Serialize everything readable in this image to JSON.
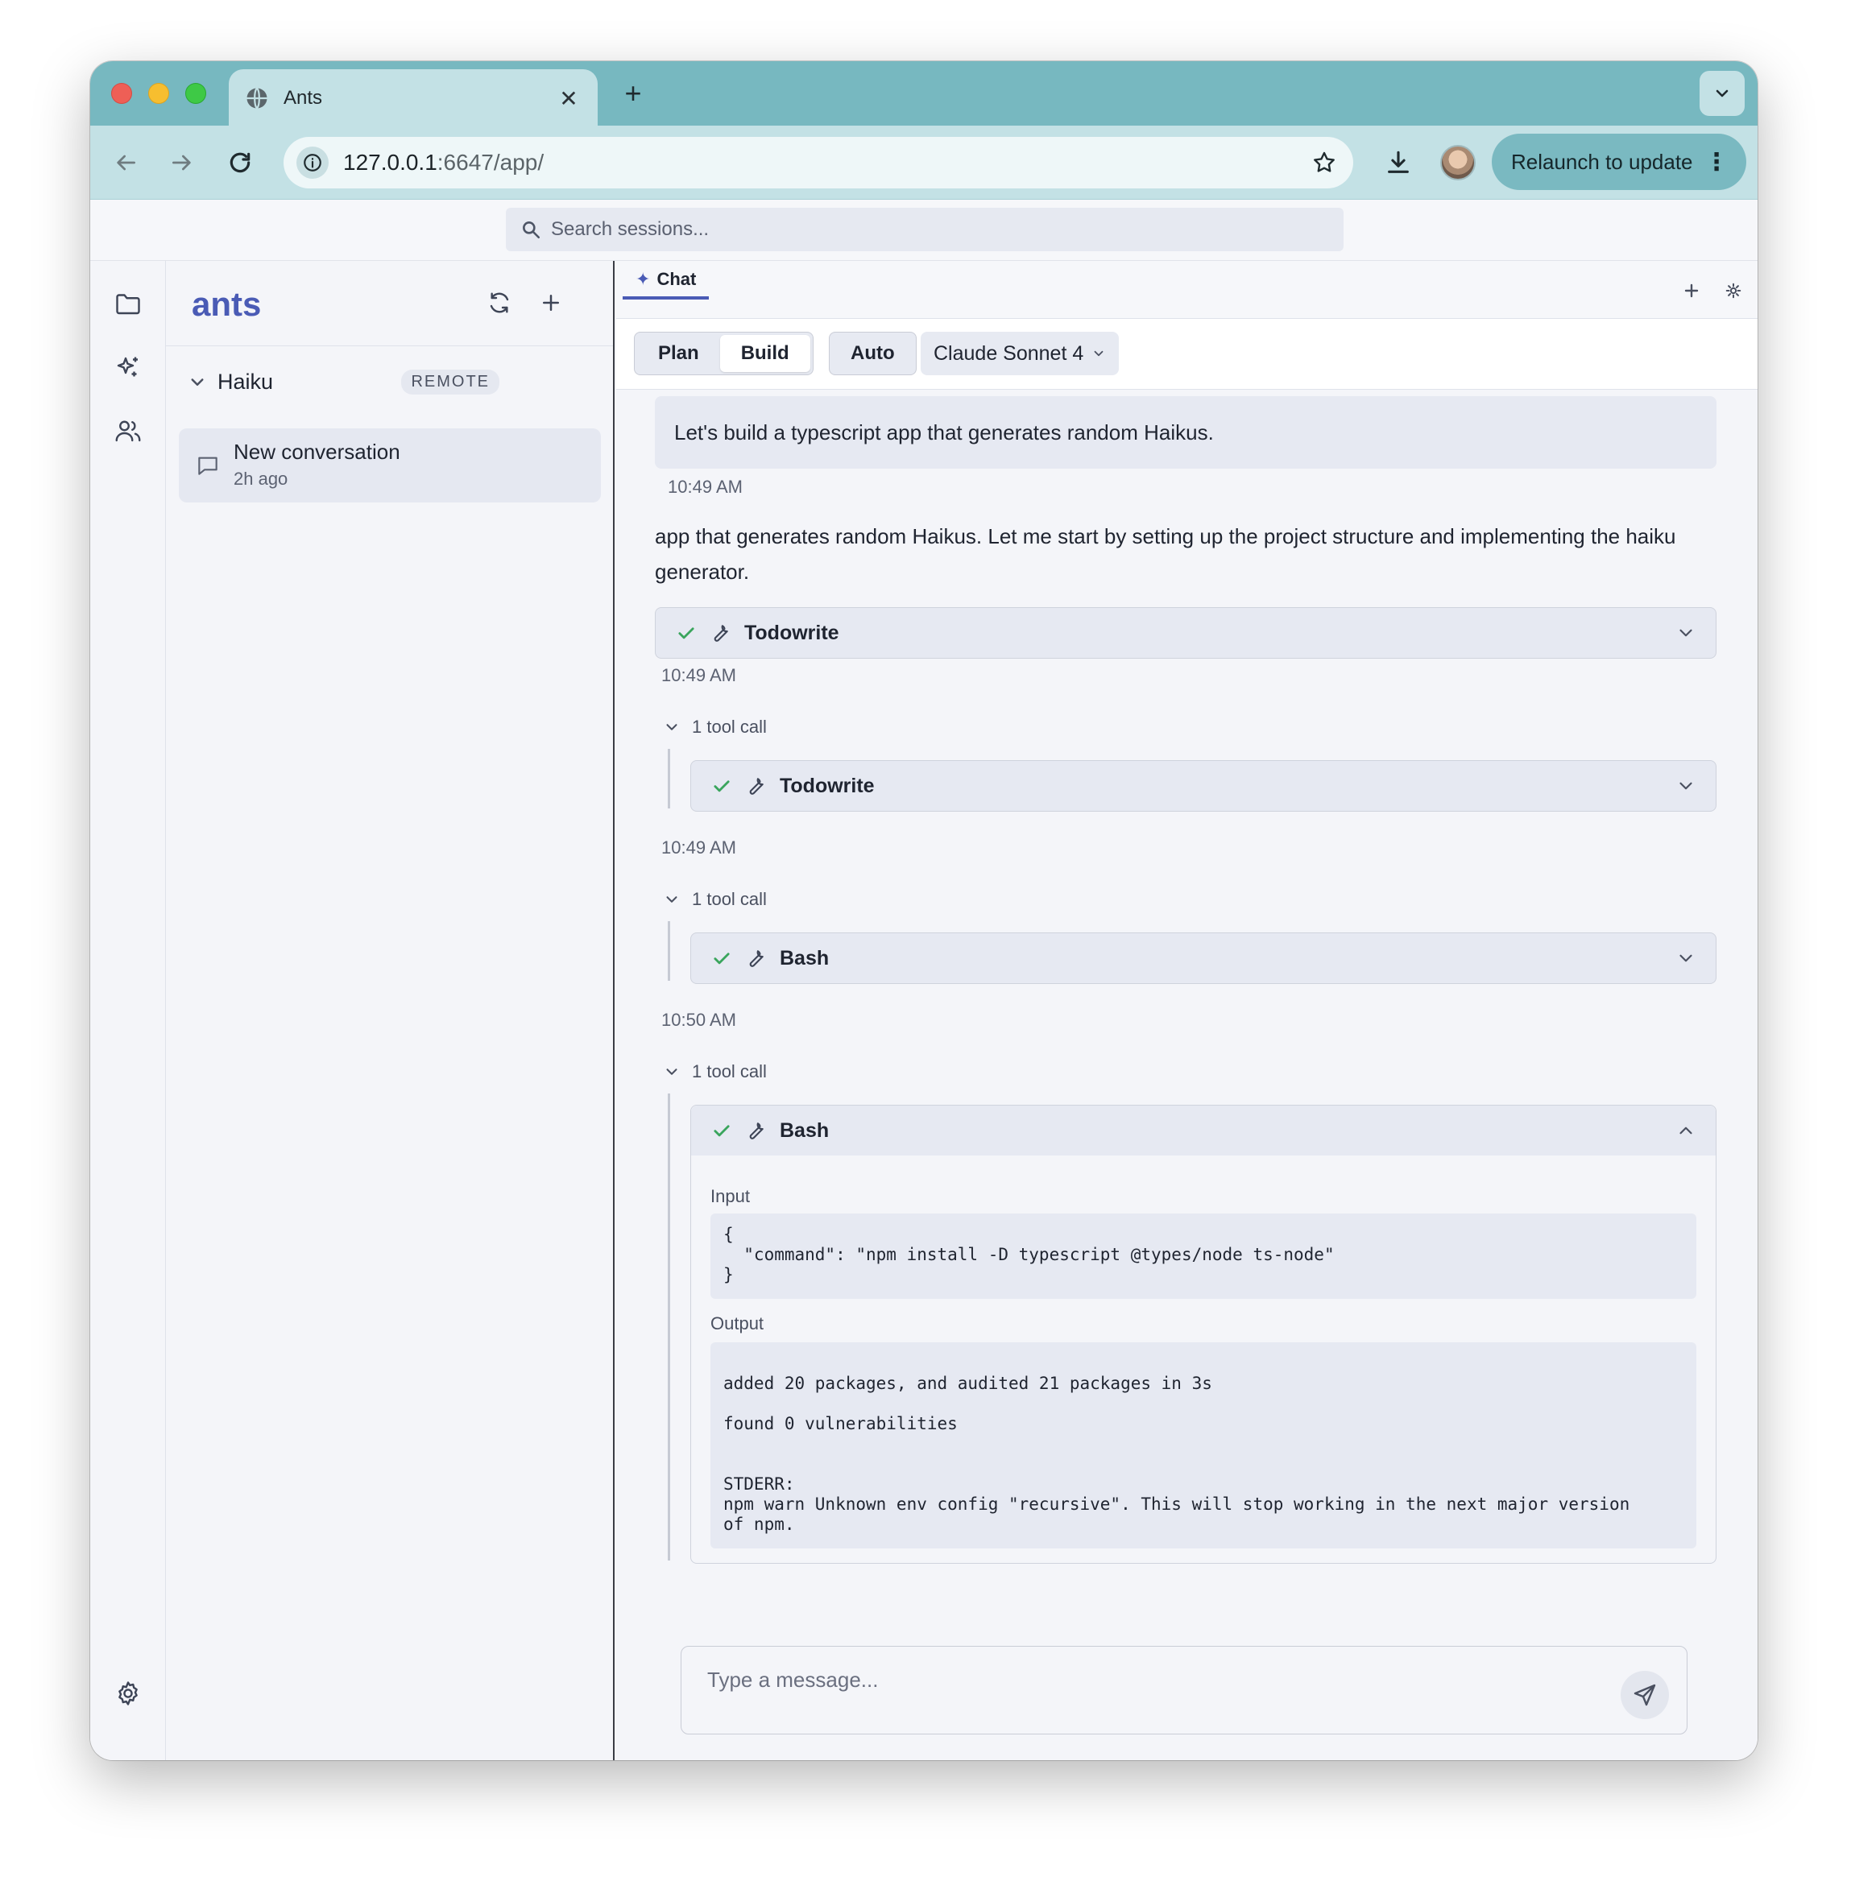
{
  "browser": {
    "tab_title": "Ants",
    "tab_close": "✕",
    "new_tab": "+",
    "url_host": "127.0.0.1",
    "url_rest": ":6647/app/",
    "relaunch_label": "Relaunch to update",
    "relaunch_menu": "⋮"
  },
  "search": {
    "placeholder": "Search sessions..."
  },
  "sessions": {
    "project_title": "ants",
    "group": {
      "name": "Haiku",
      "badge": "REMOTE"
    },
    "conversations": [
      {
        "title": "New conversation",
        "time": "2h ago"
      }
    ]
  },
  "main": {
    "tab_label": "Chat",
    "tab_icon": "✦",
    "modes": {
      "plan": "Plan",
      "build": "Build",
      "auto": "Auto",
      "active": "Build"
    },
    "model": "Claude Sonnet 4",
    "messages": {
      "user_text": "Let's build a typescript app that generates random Haikus.",
      "user_time": "10:49 AM",
      "assistant_text": "app that generates random Haikus. Let me start by setting up the project structure and implementing the haiku generator.",
      "tool1": {
        "name": "Todowrite",
        "time": "10:49 AM"
      },
      "group1": {
        "label": "1 tool call",
        "tool": "Todowrite",
        "time": "10:49 AM"
      },
      "group2": {
        "label": "1 tool call",
        "tool": "Bash",
        "time": "10:50 AM"
      },
      "group3": {
        "label": "1 tool call",
        "tool": "Bash",
        "input_label": "Input",
        "input_code": "{\n  \"command\": \"npm install -D typescript @types/node ts-node\"\n}",
        "output_label": "Output",
        "output_code": "\nadded 20 packages, and audited 21 packages in 3s\n\nfound 0 vulnerabilities\n\n\nSTDERR:\nnpm warn Unknown env config \"recursive\". This will stop working in the next major version\nof npm."
      }
    },
    "composer_placeholder": "Type a message..."
  },
  "icons": {
    "rail": [
      "folder-icon",
      "sparkles-icon",
      "users-icon",
      "gear-icon"
    ],
    "tool": [
      "check-icon",
      "wrench-icon",
      "chevron-down-icon"
    ]
  },
  "colors": {
    "accent": "#4a5bb5",
    "chrome": "#77b8c0",
    "success": "#3aa55d"
  }
}
